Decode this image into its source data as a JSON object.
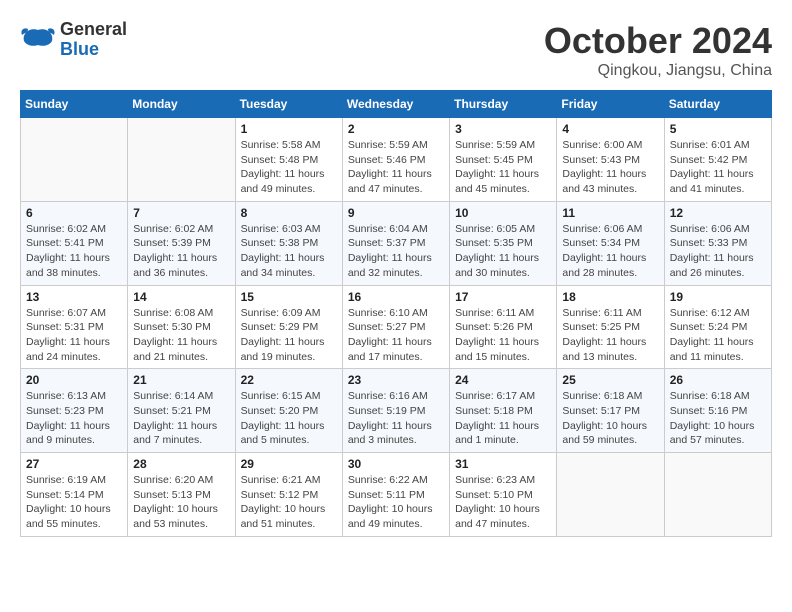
{
  "logo": {
    "text_general": "General",
    "text_blue": "Blue"
  },
  "title": "October 2024",
  "subtitle": "Qingkou, Jiangsu, China",
  "weekdays": [
    "Sunday",
    "Monday",
    "Tuesday",
    "Wednesday",
    "Thursday",
    "Friday",
    "Saturday"
  ],
  "weeks": [
    [
      {
        "day": "",
        "info": ""
      },
      {
        "day": "",
        "info": ""
      },
      {
        "day": "1",
        "info": "Sunrise: 5:58 AM\nSunset: 5:48 PM\nDaylight: 11 hours and 49 minutes."
      },
      {
        "day": "2",
        "info": "Sunrise: 5:59 AM\nSunset: 5:46 PM\nDaylight: 11 hours and 47 minutes."
      },
      {
        "day": "3",
        "info": "Sunrise: 5:59 AM\nSunset: 5:45 PM\nDaylight: 11 hours and 45 minutes."
      },
      {
        "day": "4",
        "info": "Sunrise: 6:00 AM\nSunset: 5:43 PM\nDaylight: 11 hours and 43 minutes."
      },
      {
        "day": "5",
        "info": "Sunrise: 6:01 AM\nSunset: 5:42 PM\nDaylight: 11 hours and 41 minutes."
      }
    ],
    [
      {
        "day": "6",
        "info": "Sunrise: 6:02 AM\nSunset: 5:41 PM\nDaylight: 11 hours and 38 minutes."
      },
      {
        "day": "7",
        "info": "Sunrise: 6:02 AM\nSunset: 5:39 PM\nDaylight: 11 hours and 36 minutes."
      },
      {
        "day": "8",
        "info": "Sunrise: 6:03 AM\nSunset: 5:38 PM\nDaylight: 11 hours and 34 minutes."
      },
      {
        "day": "9",
        "info": "Sunrise: 6:04 AM\nSunset: 5:37 PM\nDaylight: 11 hours and 32 minutes."
      },
      {
        "day": "10",
        "info": "Sunrise: 6:05 AM\nSunset: 5:35 PM\nDaylight: 11 hours and 30 minutes."
      },
      {
        "day": "11",
        "info": "Sunrise: 6:06 AM\nSunset: 5:34 PM\nDaylight: 11 hours and 28 minutes."
      },
      {
        "day": "12",
        "info": "Sunrise: 6:06 AM\nSunset: 5:33 PM\nDaylight: 11 hours and 26 minutes."
      }
    ],
    [
      {
        "day": "13",
        "info": "Sunrise: 6:07 AM\nSunset: 5:31 PM\nDaylight: 11 hours and 24 minutes."
      },
      {
        "day": "14",
        "info": "Sunrise: 6:08 AM\nSunset: 5:30 PM\nDaylight: 11 hours and 21 minutes."
      },
      {
        "day": "15",
        "info": "Sunrise: 6:09 AM\nSunset: 5:29 PM\nDaylight: 11 hours and 19 minutes."
      },
      {
        "day": "16",
        "info": "Sunrise: 6:10 AM\nSunset: 5:27 PM\nDaylight: 11 hours and 17 minutes."
      },
      {
        "day": "17",
        "info": "Sunrise: 6:11 AM\nSunset: 5:26 PM\nDaylight: 11 hours and 15 minutes."
      },
      {
        "day": "18",
        "info": "Sunrise: 6:11 AM\nSunset: 5:25 PM\nDaylight: 11 hours and 13 minutes."
      },
      {
        "day": "19",
        "info": "Sunrise: 6:12 AM\nSunset: 5:24 PM\nDaylight: 11 hours and 11 minutes."
      }
    ],
    [
      {
        "day": "20",
        "info": "Sunrise: 6:13 AM\nSunset: 5:23 PM\nDaylight: 11 hours and 9 minutes."
      },
      {
        "day": "21",
        "info": "Sunrise: 6:14 AM\nSunset: 5:21 PM\nDaylight: 11 hours and 7 minutes."
      },
      {
        "day": "22",
        "info": "Sunrise: 6:15 AM\nSunset: 5:20 PM\nDaylight: 11 hours and 5 minutes."
      },
      {
        "day": "23",
        "info": "Sunrise: 6:16 AM\nSunset: 5:19 PM\nDaylight: 11 hours and 3 minutes."
      },
      {
        "day": "24",
        "info": "Sunrise: 6:17 AM\nSunset: 5:18 PM\nDaylight: 11 hours and 1 minute."
      },
      {
        "day": "25",
        "info": "Sunrise: 6:18 AM\nSunset: 5:17 PM\nDaylight: 10 hours and 59 minutes."
      },
      {
        "day": "26",
        "info": "Sunrise: 6:18 AM\nSunset: 5:16 PM\nDaylight: 10 hours and 57 minutes."
      }
    ],
    [
      {
        "day": "27",
        "info": "Sunrise: 6:19 AM\nSunset: 5:14 PM\nDaylight: 10 hours and 55 minutes."
      },
      {
        "day": "28",
        "info": "Sunrise: 6:20 AM\nSunset: 5:13 PM\nDaylight: 10 hours and 53 minutes."
      },
      {
        "day": "29",
        "info": "Sunrise: 6:21 AM\nSunset: 5:12 PM\nDaylight: 10 hours and 51 minutes."
      },
      {
        "day": "30",
        "info": "Sunrise: 6:22 AM\nSunset: 5:11 PM\nDaylight: 10 hours and 49 minutes."
      },
      {
        "day": "31",
        "info": "Sunrise: 6:23 AM\nSunset: 5:10 PM\nDaylight: 10 hours and 47 minutes."
      },
      {
        "day": "",
        "info": ""
      },
      {
        "day": "",
        "info": ""
      }
    ]
  ]
}
